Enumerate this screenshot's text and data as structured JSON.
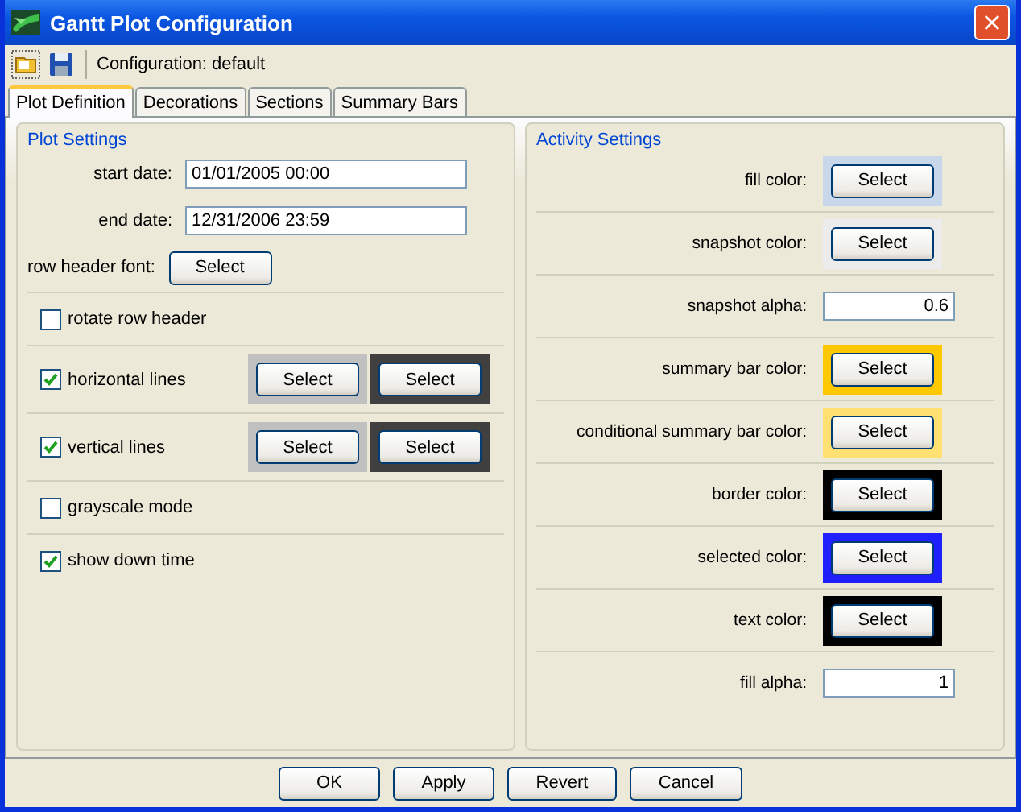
{
  "window": {
    "title": "Gantt Plot Configuration",
    "close": "×"
  },
  "toolbar": {
    "label": "Configuration: default"
  },
  "tabs": [
    {
      "label": "Plot Definition",
      "selected": true
    },
    {
      "label": "Decorations",
      "selected": false
    },
    {
      "label": "Sections",
      "selected": false
    },
    {
      "label": "Summary Bars",
      "selected": false
    }
  ],
  "plot_settings": {
    "title": "Plot Settings",
    "rows": [
      {
        "kind": "date",
        "label": "start date:",
        "value": "01/01/2005 00:00"
      },
      {
        "kind": "date",
        "label": "end date:",
        "value": "12/31/2006 23:59"
      },
      {
        "kind": "font",
        "label": "row header font:",
        "button": "Select"
      },
      {
        "kind": "check",
        "label": "rotate row header",
        "checked": false
      },
      {
        "kind": "check",
        "label": "horizontal lines",
        "checked": true,
        "swatches": [
          {
            "color": "#c0c0c0",
            "button": "Select"
          },
          {
            "color": "#404040",
            "button": "Select"
          }
        ]
      },
      {
        "kind": "check",
        "label": "vertical lines",
        "checked": true,
        "swatches": [
          {
            "color": "#c0c0c0",
            "button": "Select"
          },
          {
            "color": "#404040",
            "button": "Select"
          }
        ]
      },
      {
        "kind": "check",
        "label": "grayscale mode",
        "checked": false
      },
      {
        "kind": "check",
        "label": "show down time",
        "checked": true
      }
    ]
  },
  "activity_settings": {
    "title": "Activity Settings",
    "rows": [
      {
        "kind": "color",
        "label": "fill color:",
        "color": "#c8d8ea",
        "button": "Select"
      },
      {
        "kind": "color",
        "label": "snapshot color:",
        "color": "#ececec",
        "button": "Select"
      },
      {
        "kind": "number",
        "label": "snapshot alpha:",
        "value": "0.6"
      },
      {
        "kind": "color",
        "label": "summary bar color:",
        "color": "#ffc800",
        "button": "Select"
      },
      {
        "kind": "color",
        "label": "conditional summary bar color:",
        "color": "#ffe070",
        "button": "Select"
      },
      {
        "kind": "color",
        "label": "border color:",
        "color": "#000000",
        "button": "Select"
      },
      {
        "kind": "color",
        "label": "selected color:",
        "color": "#2020ff",
        "button": "Select"
      },
      {
        "kind": "color",
        "label": "text color:",
        "color": "#000000",
        "button": "Select"
      },
      {
        "kind": "number",
        "label": "fill alpha:",
        "value": "1"
      }
    ]
  },
  "buttons": [
    "OK",
    "Apply",
    "Revert",
    "Cancel"
  ]
}
